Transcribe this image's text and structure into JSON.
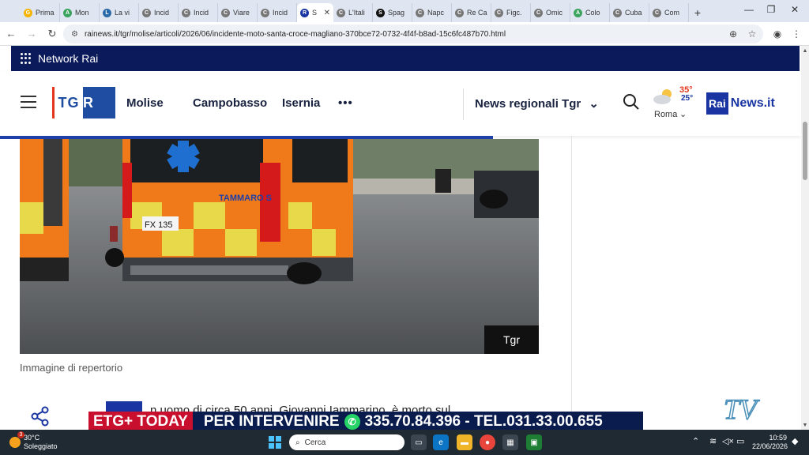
{
  "browser": {
    "tabs": [
      {
        "label": "Prima",
        "color": "#f4b400",
        "glyph": "G"
      },
      {
        "label": "Mon",
        "color": "#3aa35c",
        "glyph": "A"
      },
      {
        "label": "La vi",
        "color": "#2a6aa8",
        "glyph": "L"
      },
      {
        "label": "Incid",
        "color": "#777777",
        "glyph": "C"
      },
      {
        "label": "Incid",
        "color": "#777777",
        "glyph": "C"
      },
      {
        "label": "Viare",
        "color": "#777777",
        "glyph": "C"
      },
      {
        "label": "Incid",
        "color": "#777777",
        "glyph": "C"
      },
      {
        "label": "S",
        "color": "#1a35a1",
        "glyph": "R",
        "active": true
      },
      {
        "label": "L'Itali",
        "color": "#777777",
        "glyph": "C"
      },
      {
        "label": "Spag",
        "color": "#111111",
        "glyph": "S"
      },
      {
        "label": "Napc",
        "color": "#777777",
        "glyph": "C"
      },
      {
        "label": "Re Ca",
        "color": "#777777",
        "glyph": "C"
      },
      {
        "label": "Figc.",
        "color": "#777777",
        "glyph": "C"
      },
      {
        "label": "Omic",
        "color": "#777777",
        "glyph": "C"
      },
      {
        "label": "Colo",
        "color": "#3aa35c",
        "glyph": "A"
      },
      {
        "label": "Cuba",
        "color": "#777777",
        "glyph": "C"
      },
      {
        "label": "Com",
        "color": "#777777",
        "glyph": "C"
      }
    ],
    "url": "rainews.it/tgr/molise/articoli/2026/06/incidente-moto-santa-croce-magliano-370bce72-0732-4f4f-b8ad-15c6fc487b70.html"
  },
  "site": {
    "network_label": "Network Rai",
    "logo_left": "TG",
    "logo_right": "R",
    "region": "Molise",
    "nav": [
      "Campobasso",
      "Isernia"
    ],
    "more": "•••",
    "regional": "News regionali Tgr",
    "weather": {
      "high": "35°",
      "low": "25°",
      "city": "Roma"
    },
    "brand_rai": "Rai",
    "brand_news": "News.it"
  },
  "article": {
    "photo_tag": "Tgr",
    "caption": "Immagine di repertorio",
    "text_visible": "n uomo di circa 50 anni, Giovanni Iammarino, è morto sul",
    "ambulance_plate": "FX 135",
    "ambulance_name": "TAMMARO S"
  },
  "overlay": {
    "ticker_left": "ETG+ TODAY",
    "ticker_right": "PER INTERVENIRE",
    "ticker_phone": "335.70.84.396 - TEL.031.33.00.655",
    "watermark": "TV"
  },
  "taskbar": {
    "temp": "30°C",
    "condition": "Soleggiato",
    "badge": "3",
    "search": "Cerca",
    "time": "10:59",
    "date": "22/06/2026"
  }
}
